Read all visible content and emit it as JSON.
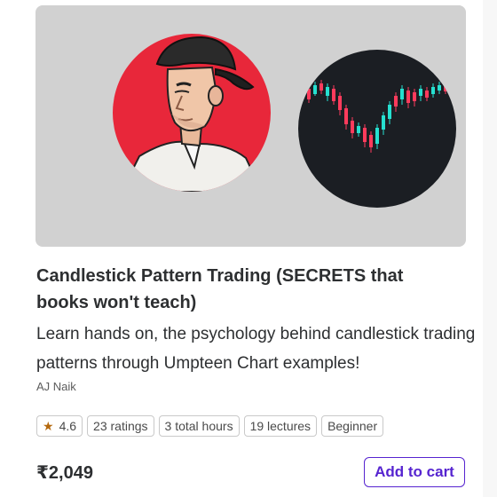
{
  "course": {
    "title": "Candlestick Pattern Trading (SECRETS that books won't teach)",
    "description": "Learn hands on, the psychology behind candlestick trading patterns through Umpteen Chart examples!",
    "author": "AJ Naik",
    "rating": "4.6",
    "ratings_count": "23 ratings",
    "duration": "3 total hours",
    "lectures": "19 lectures",
    "level": "Beginner",
    "price": "₹2,049"
  },
  "actions": {
    "add_to_cart": "Add to cart"
  },
  "icons": {
    "rating": "star-icon"
  },
  "colors": {
    "accent": "#5624d0",
    "star": "#b4690e",
    "thumbnail_bg": "#d1d1d1",
    "avatar_bg": "#e8273a",
    "chart_bg": "#1b1e23",
    "bull_candle": "#26e0d0",
    "bear_candle": "#ff3b5c"
  }
}
